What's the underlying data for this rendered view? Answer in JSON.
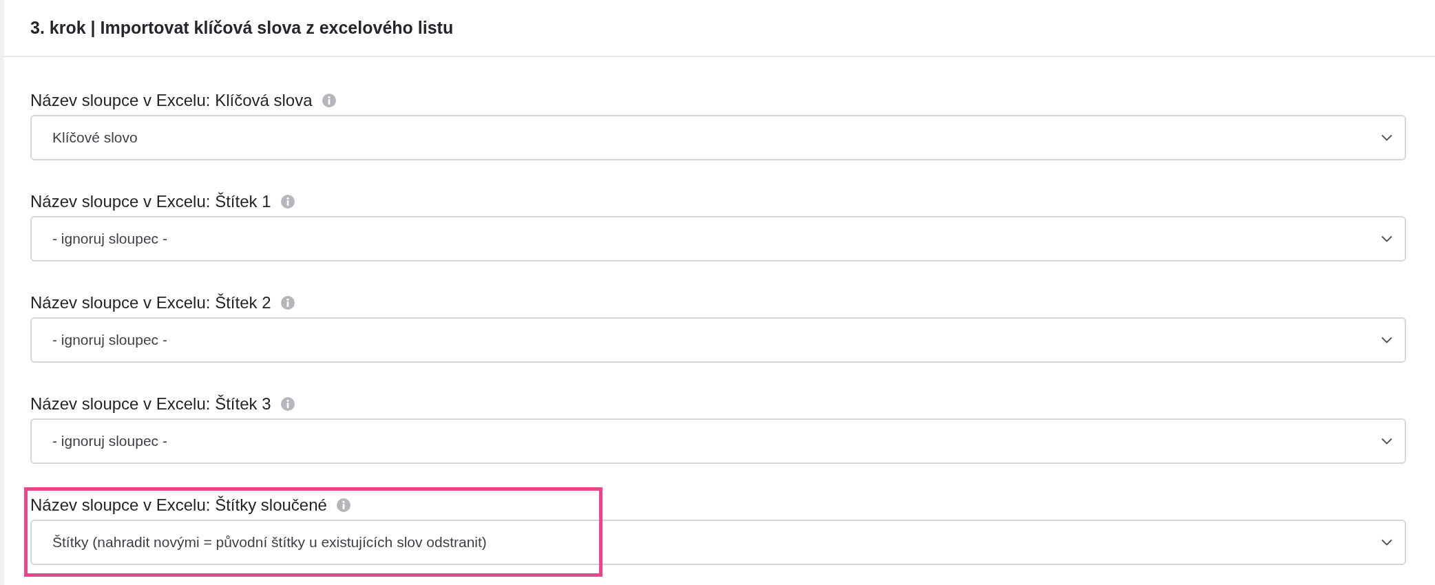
{
  "card": {
    "title": "3. krok | Importovat klíčová slova z excelového listu"
  },
  "fields": [
    {
      "label": "Název sloupce v Excelu: Klíčová slova",
      "value": "Klíčové slovo",
      "highlighted": false
    },
    {
      "label": "Název sloupce v Excelu: Štítek 1",
      "value": "- ignoruj sloupec -",
      "highlighted": false
    },
    {
      "label": "Název sloupce v Excelu: Štítek 2",
      "value": "- ignoruj sloupec -",
      "highlighted": false
    },
    {
      "label": "Název sloupce v Excelu: Štítek 3",
      "value": "- ignoruj sloupec -",
      "highlighted": false
    },
    {
      "label": "Název sloupce v Excelu: Štítky sloučené",
      "value": "Štítky (nahradit novými = původní štítky u existujících slov odstranit)",
      "highlighted": true
    }
  ]
}
